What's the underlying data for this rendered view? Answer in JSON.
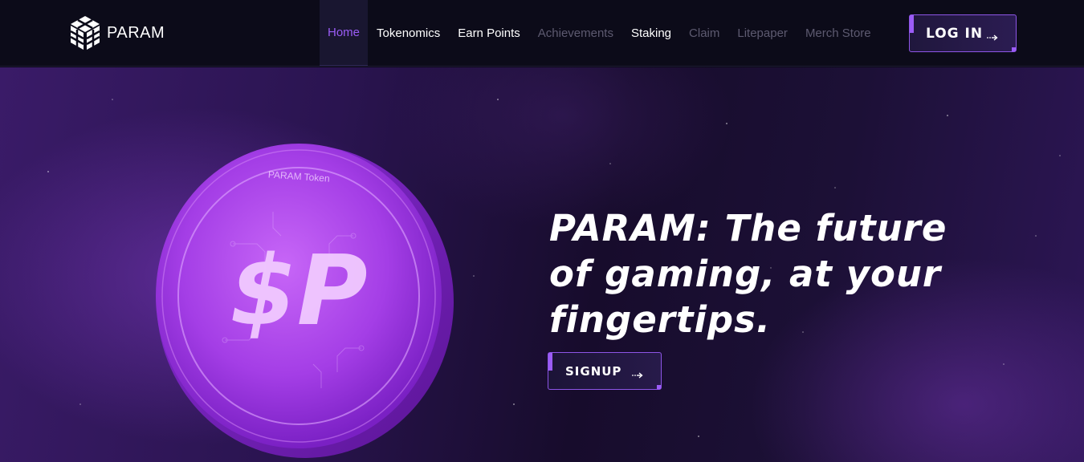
{
  "brand": {
    "name": "PARAM",
    "logo_icon": "param-cube-logo-icon"
  },
  "nav": {
    "items": [
      {
        "label": "Home",
        "state": "active"
      },
      {
        "label": "Tokenomics",
        "state": "normal"
      },
      {
        "label": "Earn Points",
        "state": "normal"
      },
      {
        "label": "Achievements",
        "state": "muted"
      },
      {
        "label": "Staking",
        "state": "normal"
      },
      {
        "label": "Claim",
        "state": "muted"
      },
      {
        "label": "Litepaper",
        "state": "muted"
      },
      {
        "label": "Merch Store",
        "state": "muted"
      }
    ]
  },
  "header": {
    "login_label": "LOG IN",
    "login_icon": "arrow-right-icon"
  },
  "hero": {
    "headline_lines": [
      "PARAM: The future",
      "of gaming, at your",
      "fingertips."
    ],
    "signup_label": "SIGNUP",
    "signup_icon": "arrow-right-icon",
    "coin": {
      "symbol": "$P",
      "ring_text": "PARAM Token"
    }
  },
  "colors": {
    "accent": "#9b5cf6",
    "background": "#0c0b19",
    "nav_active": "#9a5cf5",
    "nav_muted": "#5d5a70",
    "coin": "#b44df0"
  }
}
